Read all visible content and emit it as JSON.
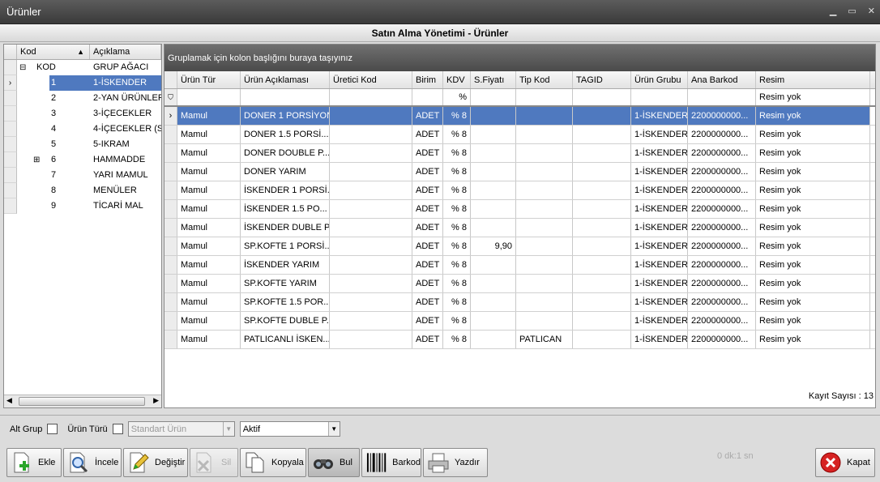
{
  "window": {
    "title": "Ürünler",
    "app_title": "Satın Alma Yönetimi - Ürünler"
  },
  "tree": {
    "col_kod": "Kod",
    "col_aciklama": "Açıklama",
    "rows": [
      {
        "kod": "KOD",
        "aciklama": "GRUP AĞACI"
      },
      {
        "kod": "1",
        "aciklama": "1-İSKENDER"
      },
      {
        "kod": "2",
        "aciklama": "2-YAN ÜRÜNLER"
      },
      {
        "kod": "3",
        "aciklama": "3-İÇECEKLER"
      },
      {
        "kod": "4",
        "aciklama": "4-İÇECEKLER (SU"
      },
      {
        "kod": "5",
        "aciklama": "5-IKRAM"
      },
      {
        "kod": "6",
        "aciklama": "HAMMADDE"
      },
      {
        "kod": "7",
        "aciklama": "YARI MAMUL"
      },
      {
        "kod": "8",
        "aciklama": "MENÜLER"
      },
      {
        "kod": "9",
        "aciklama": "TİCARİ MAL"
      }
    ]
  },
  "grid": {
    "group_hint": "Gruplamak için kolon başlığını buraya taşıyınız",
    "columns": [
      "Ürün Tür",
      "Ürün Açıklaması",
      "Üretici Kod",
      "Birim",
      "KDV",
      "S.Fiyatı",
      "Tip Kod",
      "TAGID",
      "Ürün Grubu",
      "Ana Barkod",
      "Resim"
    ],
    "filter": {
      "kdv": "%",
      "resim": "Resim yok"
    },
    "rows": [
      [
        "Mamul",
        "DONER 1 PORSİYON",
        "",
        "ADET",
        "% 8",
        "",
        "",
        "",
        "1-İSKENDER",
        "2200000000...",
        "Resim yok"
      ],
      [
        "Mamul",
        "DONER 1.5 PORSİ...",
        "",
        "ADET",
        "% 8",
        "",
        "",
        "",
        "1-İSKENDER",
        "2200000000...",
        "Resim yok"
      ],
      [
        "Mamul",
        "DONER DOUBLE P...",
        "",
        "ADET",
        "% 8",
        "",
        "",
        "",
        "1-İSKENDER",
        "2200000000...",
        "Resim yok"
      ],
      [
        "Mamul",
        "DONER YARIM",
        "",
        "ADET",
        "% 8",
        "",
        "",
        "",
        "1-İSKENDER",
        "2200000000...",
        "Resim yok"
      ],
      [
        "Mamul",
        "İSKENDER 1 PORSİ...",
        "",
        "ADET",
        "% 8",
        "",
        "",
        "",
        "1-İSKENDER",
        "2200000000...",
        "Resim yok"
      ],
      [
        "Mamul",
        "İSKENDER 1.5 PO...",
        "",
        "ADET",
        "% 8",
        "",
        "",
        "",
        "1-İSKENDER",
        "2200000000...",
        "Resim yok"
      ],
      [
        "Mamul",
        "İSKENDER DUBLE P...",
        "",
        "ADET",
        "% 8",
        "",
        "",
        "",
        "1-İSKENDER",
        "2200000000...",
        "Resim yok"
      ],
      [
        "Mamul",
        "SP.KOFTE 1 PORSİ...",
        "",
        "ADET",
        "% 8",
        "9,90",
        "",
        "",
        "1-İSKENDER",
        "2200000000...",
        "Resim yok"
      ],
      [
        "Mamul",
        "İSKENDER YARIM",
        "",
        "ADET",
        "% 8",
        "",
        "",
        "",
        "1-İSKENDER",
        "2200000000...",
        "Resim yok"
      ],
      [
        "Mamul",
        "SP.KOFTE YARIM",
        "",
        "ADET",
        "% 8",
        "",
        "",
        "",
        "1-İSKENDER",
        "2200000000...",
        "Resim yok"
      ],
      [
        "Mamul",
        "SP.KOFTE 1.5 POR...",
        "",
        "ADET",
        "% 8",
        "",
        "",
        "",
        "1-İSKENDER",
        "2200000000...",
        "Resim yok"
      ],
      [
        "Mamul",
        "SP.KOFTE DUBLE P...",
        "",
        "ADET",
        "% 8",
        "",
        "",
        "",
        "1-İSKENDER",
        "2200000000...",
        "Resim yok"
      ],
      [
        "Mamul",
        "PATLICANLI İSKEN...",
        "",
        "ADET",
        "% 8",
        "",
        "PATLICAN",
        "",
        "1-İSKENDER",
        "2200000000...",
        "Resim yok"
      ]
    ],
    "record_count": "Kayıt Sayısı : 13"
  },
  "filterbar": {
    "alt_grup": "Alt Grup",
    "urun_turu": "Ürün Türü",
    "urun_turu_value": "Standart Ürün",
    "durum_value": "Aktif"
  },
  "toolbar": {
    "ekle": "Ekle",
    "incele": "İncele",
    "degistir": "Değiştir",
    "sil": "Sil",
    "kopyala": "Kopyala",
    "bul": "Bul",
    "barkod": "Barkod",
    "yazdir": "Yazdır",
    "kapat": "Kapat",
    "elapsed": "0 dk:1 sn"
  }
}
